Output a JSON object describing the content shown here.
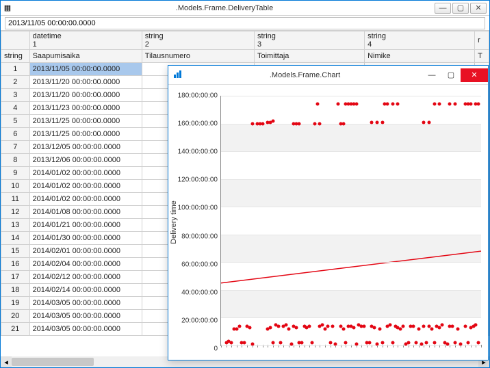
{
  "main": {
    "title": ".Models.Frame.DeliveryTable",
    "icon": "table-icon",
    "address": "2013/11/05 00:00:00.0000",
    "col_corner": "string",
    "columns": [
      {
        "type": "datetime",
        "num": "1",
        "header": "Saapumisaika"
      },
      {
        "type": "string",
        "num": "2",
        "header": "Tilausnumero"
      },
      {
        "type": "string",
        "num": "3",
        "header": "Toimittaja"
      },
      {
        "type": "string",
        "num": "4",
        "header": "Nimike"
      },
      {
        "type": "r",
        "num": "",
        "header": "T"
      }
    ],
    "rows": [
      {
        "n": "1",
        "v": "2013/11/05 00:00:00.0000",
        "sel": true
      },
      {
        "n": "2",
        "v": "2013/11/20 00:00:00.0000"
      },
      {
        "n": "3",
        "v": "2013/11/20 00:00:00.0000"
      },
      {
        "n": "4",
        "v": "2013/11/23 00:00:00.0000"
      },
      {
        "n": "5",
        "v": "2013/11/25 00:00:00.0000"
      },
      {
        "n": "6",
        "v": "2013/11/25 00:00:00.0000"
      },
      {
        "n": "7",
        "v": "2013/12/05 00:00:00.0000"
      },
      {
        "n": "8",
        "v": "2013/12/06 00:00:00.0000"
      },
      {
        "n": "9",
        "v": "2014/01/02 00:00:00.0000"
      },
      {
        "n": "10",
        "v": "2014/01/02 00:00:00.0000"
      },
      {
        "n": "11",
        "v": "2014/01/02 00:00:00.0000"
      },
      {
        "n": "12",
        "v": "2014/01/08 00:00:00.0000"
      },
      {
        "n": "13",
        "v": "2014/01/21 00:00:00.0000"
      },
      {
        "n": "14",
        "v": "2014/01/30 00:00:00.0000"
      },
      {
        "n": "15",
        "v": "2014/02/01 00:00:00.0000"
      },
      {
        "n": "16",
        "v": "2014/02/04 00:00:00.0000"
      },
      {
        "n": "17",
        "v": "2014/02/12 00:00:00.0000"
      },
      {
        "n": "18",
        "v": "2014/02/14 00:00:00.0000"
      },
      {
        "n": "19",
        "v": "2014/03/05 00:00:00.0000"
      },
      {
        "n": "20",
        "v": "2014/03/05 00:00:00.0000"
      },
      {
        "n": "21",
        "v": "2014/03/05 00:00:00.0000"
      }
    ]
  },
  "chart_window": {
    "title": ".Models.Frame.Chart",
    "icon": "chart-icon"
  },
  "chart_data": {
    "type": "scatter",
    "title": "",
    "xlabel": "",
    "ylabel": "Delivery time",
    "ylim": [
      0,
      180
    ],
    "xlim": [
      0,
      100
    ],
    "yticks": [
      "0",
      "20:00:00:00",
      "40:00:00:00",
      "60:00:00:00",
      "80:00:00:00",
      "100:00:00:00",
      "120:00:00:00",
      "140:00:00:00",
      "160:00:00:00",
      "180:00:00:00"
    ],
    "trend": {
      "x1": 0,
      "y1": 45,
      "x2": 100,
      "y2": 68
    },
    "series": [
      {
        "name": "Delivery time",
        "color": "#e30613",
        "values": [
          [
            2,
            2
          ],
          [
            3,
            3
          ],
          [
            4,
            2
          ],
          [
            5,
            12
          ],
          [
            6,
            12
          ],
          [
            7,
            14
          ],
          [
            8,
            2
          ],
          [
            9,
            2
          ],
          [
            10,
            14
          ],
          [
            11,
            13
          ],
          [
            12,
            1
          ],
          [
            12,
            160
          ],
          [
            14,
            160
          ],
          [
            15,
            160
          ],
          [
            16,
            160
          ],
          [
            18,
            161
          ],
          [
            19,
            161
          ],
          [
            20,
            162
          ],
          [
            18,
            12
          ],
          [
            19,
            13
          ],
          [
            20,
            2
          ],
          [
            21,
            15
          ],
          [
            22,
            14
          ],
          [
            23,
            2
          ],
          [
            24,
            14
          ],
          [
            25,
            15
          ],
          [
            26,
            12
          ],
          [
            27,
            1
          ],
          [
            28,
            160
          ],
          [
            29,
            160
          ],
          [
            30,
            160
          ],
          [
            28,
            14
          ],
          [
            29,
            13
          ],
          [
            30,
            2
          ],
          [
            31,
            2
          ],
          [
            32,
            14
          ],
          [
            33,
            13
          ],
          [
            34,
            14
          ],
          [
            35,
            2
          ],
          [
            36,
            160
          ],
          [
            37,
            174
          ],
          [
            38,
            160
          ],
          [
            38,
            14
          ],
          [
            39,
            15
          ],
          [
            40,
            12
          ],
          [
            41,
            14
          ],
          [
            42,
            2
          ],
          [
            43,
            14
          ],
          [
            44,
            1
          ],
          [
            45,
            174
          ],
          [
            46,
            160
          ],
          [
            47,
            160
          ],
          [
            48,
            174
          ],
          [
            49,
            174
          ],
          [
            50,
            174
          ],
          [
            51,
            174
          ],
          [
            52,
            174
          ],
          [
            46,
            14
          ],
          [
            47,
            12
          ],
          [
            48,
            2
          ],
          [
            49,
            14
          ],
          [
            50,
            14
          ],
          [
            51,
            13
          ],
          [
            52,
            1
          ],
          [
            53,
            15
          ],
          [
            54,
            14
          ],
          [
            55,
            14
          ],
          [
            56,
            2
          ],
          [
            57,
            2
          ],
          [
            58,
            14
          ],
          [
            59,
            13
          ],
          [
            60,
            1
          ],
          [
            61,
            12
          ],
          [
            62,
            2
          ],
          [
            58,
            161
          ],
          [
            60,
            161
          ],
          [
            62,
            161
          ],
          [
            63,
            174
          ],
          [
            64,
            174
          ],
          [
            66,
            174
          ],
          [
            68,
            174
          ],
          [
            64,
            14
          ],
          [
            65,
            15
          ],
          [
            66,
            2
          ],
          [
            67,
            14
          ],
          [
            68,
            13
          ],
          [
            69,
            12
          ],
          [
            70,
            14
          ],
          [
            71,
            1
          ],
          [
            72,
            2
          ],
          [
            73,
            14
          ],
          [
            74,
            14
          ],
          [
            75,
            2
          ],
          [
            76,
            12
          ],
          [
            77,
            1
          ],
          [
            78,
            14
          ],
          [
            79,
            2
          ],
          [
            78,
            161
          ],
          [
            80,
            161
          ],
          [
            82,
            174
          ],
          [
            84,
            174
          ],
          [
            88,
            174
          ],
          [
            90,
            174
          ],
          [
            80,
            14
          ],
          [
            81,
            12
          ],
          [
            82,
            2
          ],
          [
            83,
            14
          ],
          [
            84,
            13
          ],
          [
            85,
            15
          ],
          [
            86,
            2
          ],
          [
            87,
            1
          ],
          [
            88,
            14
          ],
          [
            89,
            14
          ],
          [
            90,
            2
          ],
          [
            91,
            12
          ],
          [
            92,
            1
          ],
          [
            94,
            174
          ],
          [
            95,
            174
          ],
          [
            96,
            174
          ],
          [
            98,
            174
          ],
          [
            99,
            174
          ],
          [
            94,
            14
          ],
          [
            95,
            2
          ],
          [
            96,
            13
          ],
          [
            97,
            14
          ],
          [
            98,
            15
          ],
          [
            99,
            2
          ]
        ]
      }
    ]
  }
}
